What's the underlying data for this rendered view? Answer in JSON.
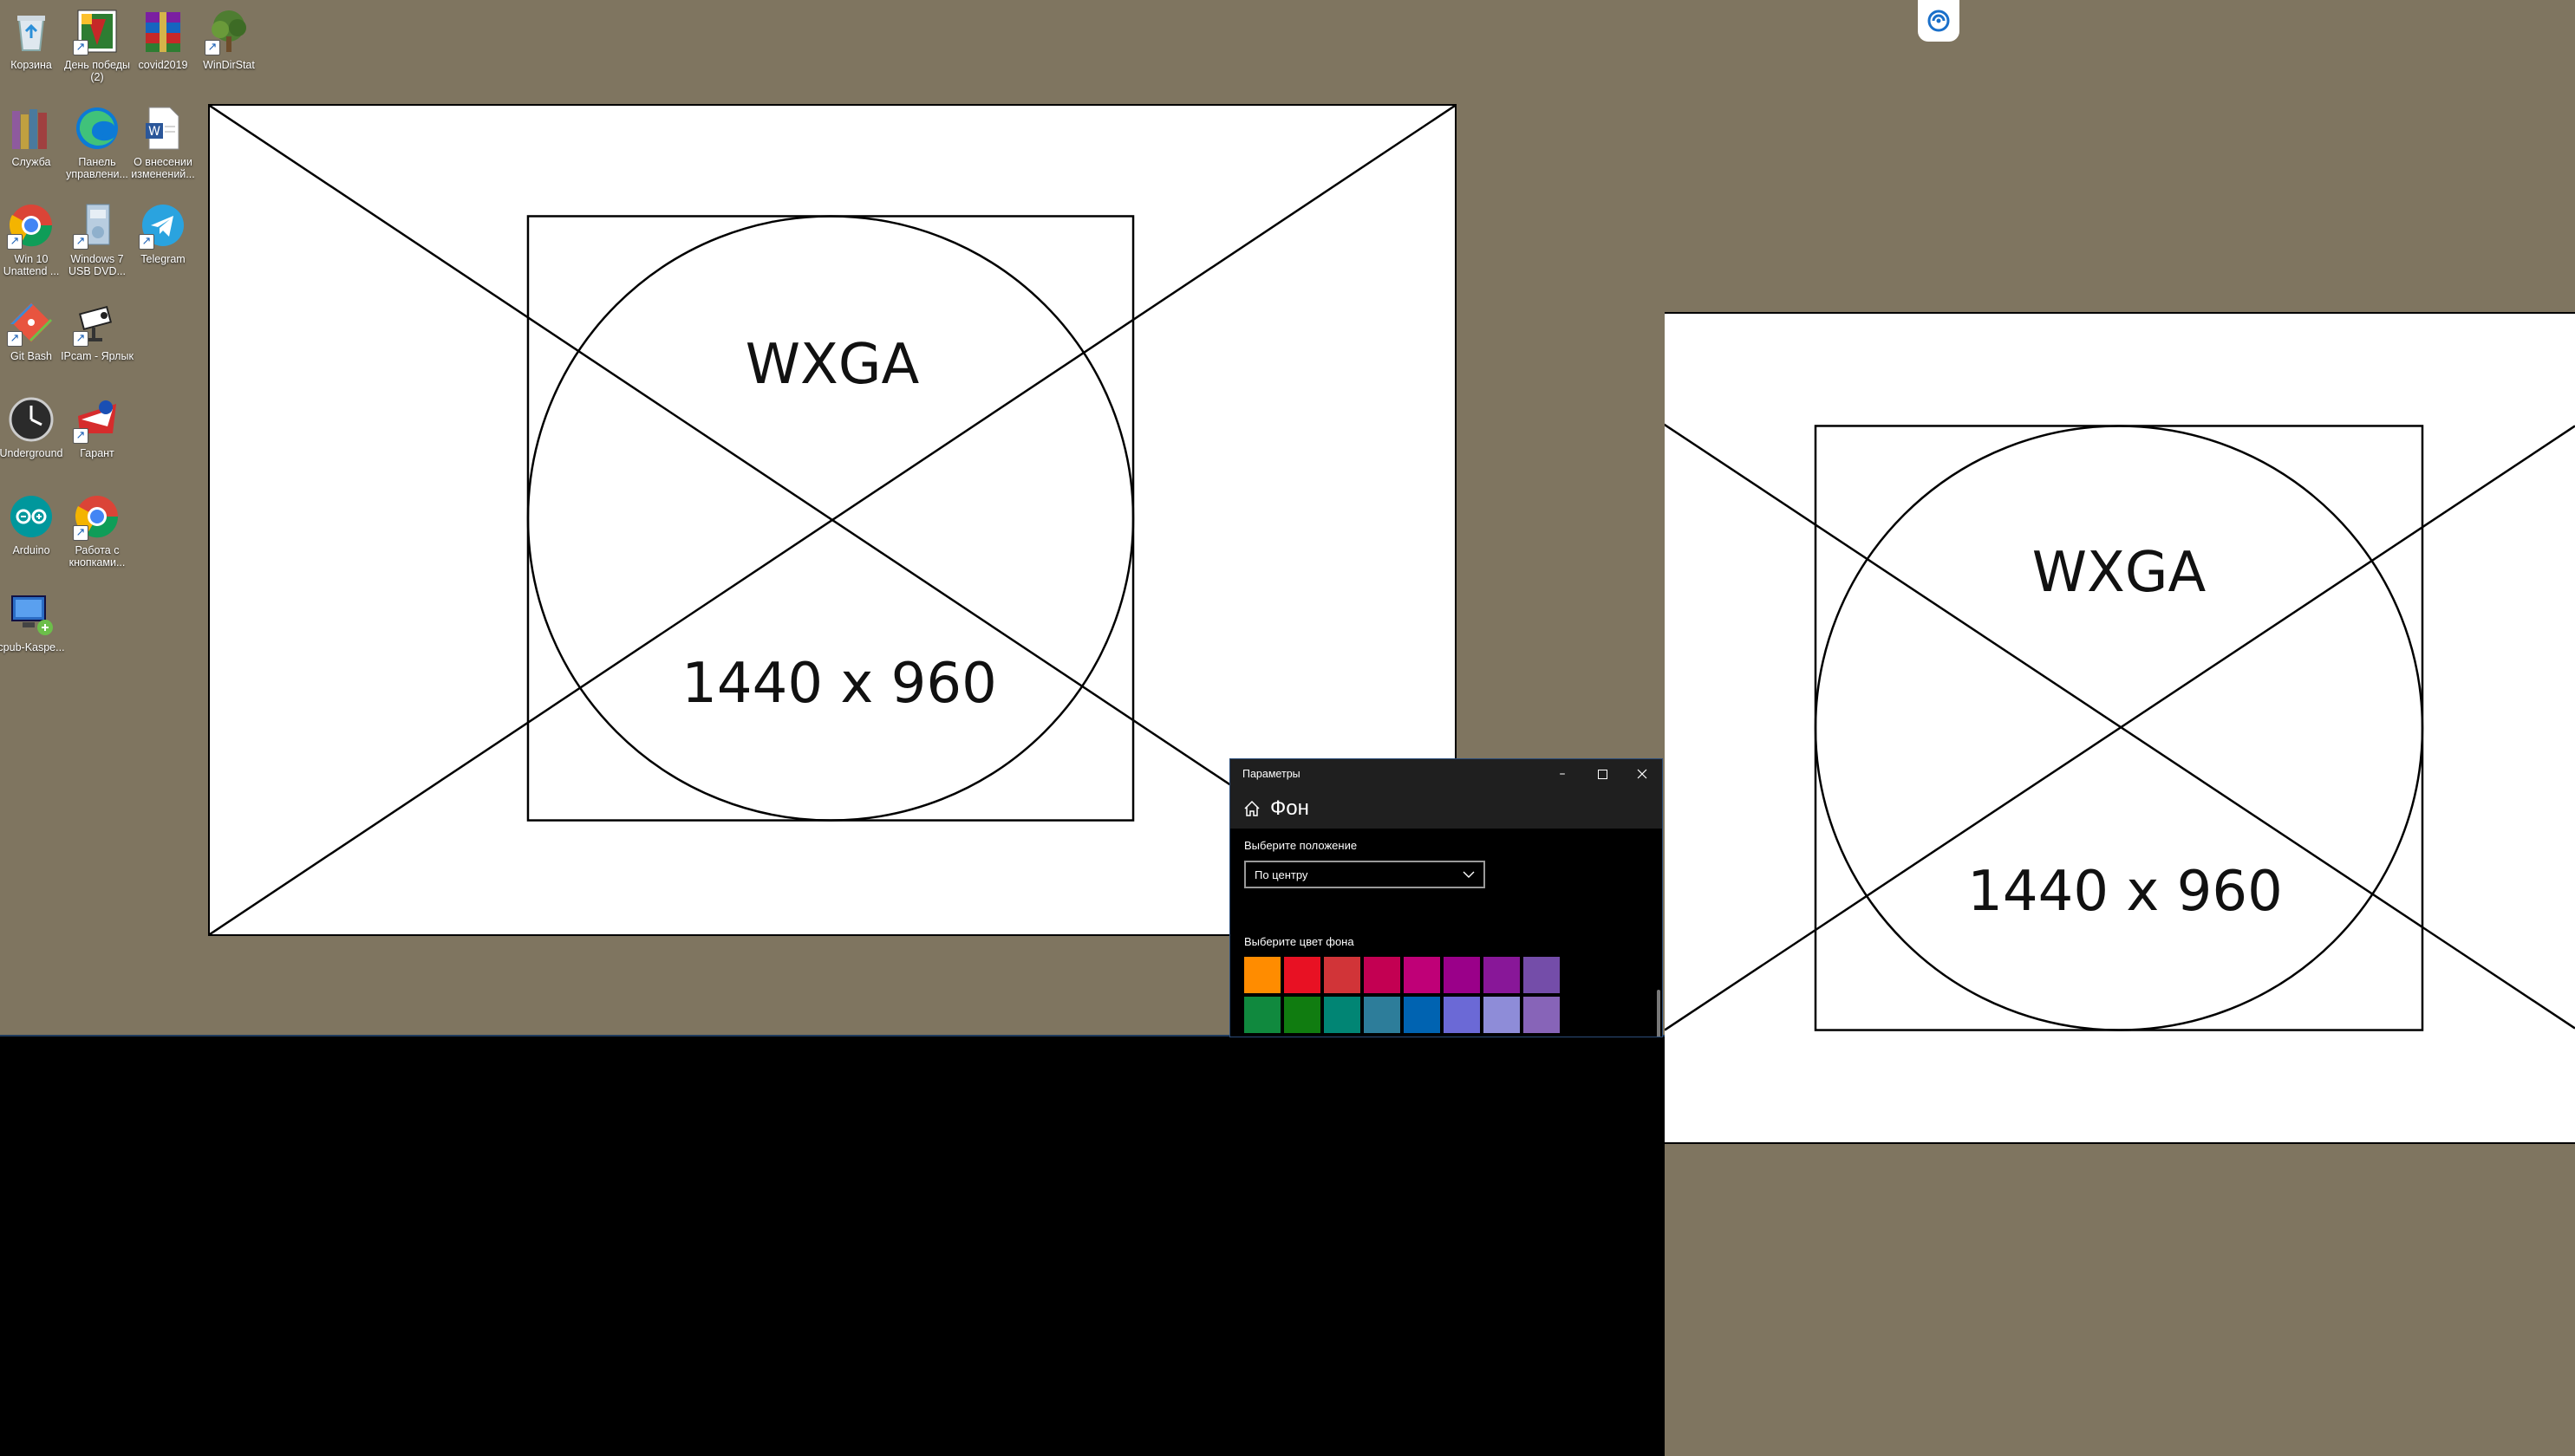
{
  "desktop": {
    "icons": [
      {
        "label": "Корзина",
        "icon": "recycle-bin-icon",
        "shortcut": false
      },
      {
        "label": "День победы (2)",
        "icon": "victory-day-icon",
        "shortcut": true
      },
      {
        "label": "covid2019",
        "icon": "winrar-archive-icon",
        "shortcut": false
      },
      {
        "label": "WinDirStat",
        "icon": "windirstat-tree-icon",
        "shortcut": true
      },
      {
        "label": "Служба",
        "icon": "books-icon",
        "shortcut": false
      },
      {
        "label": "Панель управлени...",
        "icon": "edge-icon",
        "shortcut": false
      },
      {
        "label": "О внесении изменений...",
        "icon": "word-document-icon",
        "shortcut": false
      },
      {
        "label": "Win 10 Unattend ...",
        "icon": "chrome-icon",
        "shortcut": true
      },
      {
        "label": "Windows 7 USB DVD...",
        "icon": "usb-dvd-tool-icon",
        "shortcut": true
      },
      {
        "label": "Telegram",
        "icon": "telegram-icon",
        "shortcut": true
      },
      {
        "label": "Git Bash",
        "icon": "git-bash-icon",
        "shortcut": true
      },
      {
        "label": "IPcam - Ярлык",
        "icon": "ipcam-icon",
        "shortcut": true
      },
      {
        "label": "Underground",
        "icon": "clock-icon",
        "shortcut": false
      },
      {
        "label": "Гарант",
        "icon": "garant-icon",
        "shortcut": true
      },
      {
        "label": "Arduino",
        "icon": "arduino-icon",
        "shortcut": false
      },
      {
        "label": "Работа с кнопками...",
        "icon": "chrome-icon",
        "shortcut": true
      },
      {
        "label": "cpub-Kaspe...",
        "icon": "remote-desktop-icon",
        "shortcut": false
      }
    ]
  },
  "wallpaper_left": {
    "title": "WXGA",
    "resolution": "1440 x 960"
  },
  "wallpaper_right": {
    "title": "WXGA",
    "resolution": "1440 x 960"
  },
  "settings": {
    "window_title": "Параметры",
    "page_title": "Фон",
    "position_label": "Выберите положение",
    "position_value": "По центру",
    "color_label": "Выберите цвет фона",
    "colors": [
      "#ff8c00",
      "#e81123",
      "#d13438",
      "#c30052",
      "#bf0077",
      "#9a0089",
      "#881798",
      "#744da9",
      "#10893e",
      "#107c10",
      "#018574",
      "#2d7d9a",
      "#0063b1",
      "#6b69d6",
      "#8e8cd8",
      "#8764b8"
    ]
  },
  "tray": {
    "icon": "remote-assist-icon"
  }
}
